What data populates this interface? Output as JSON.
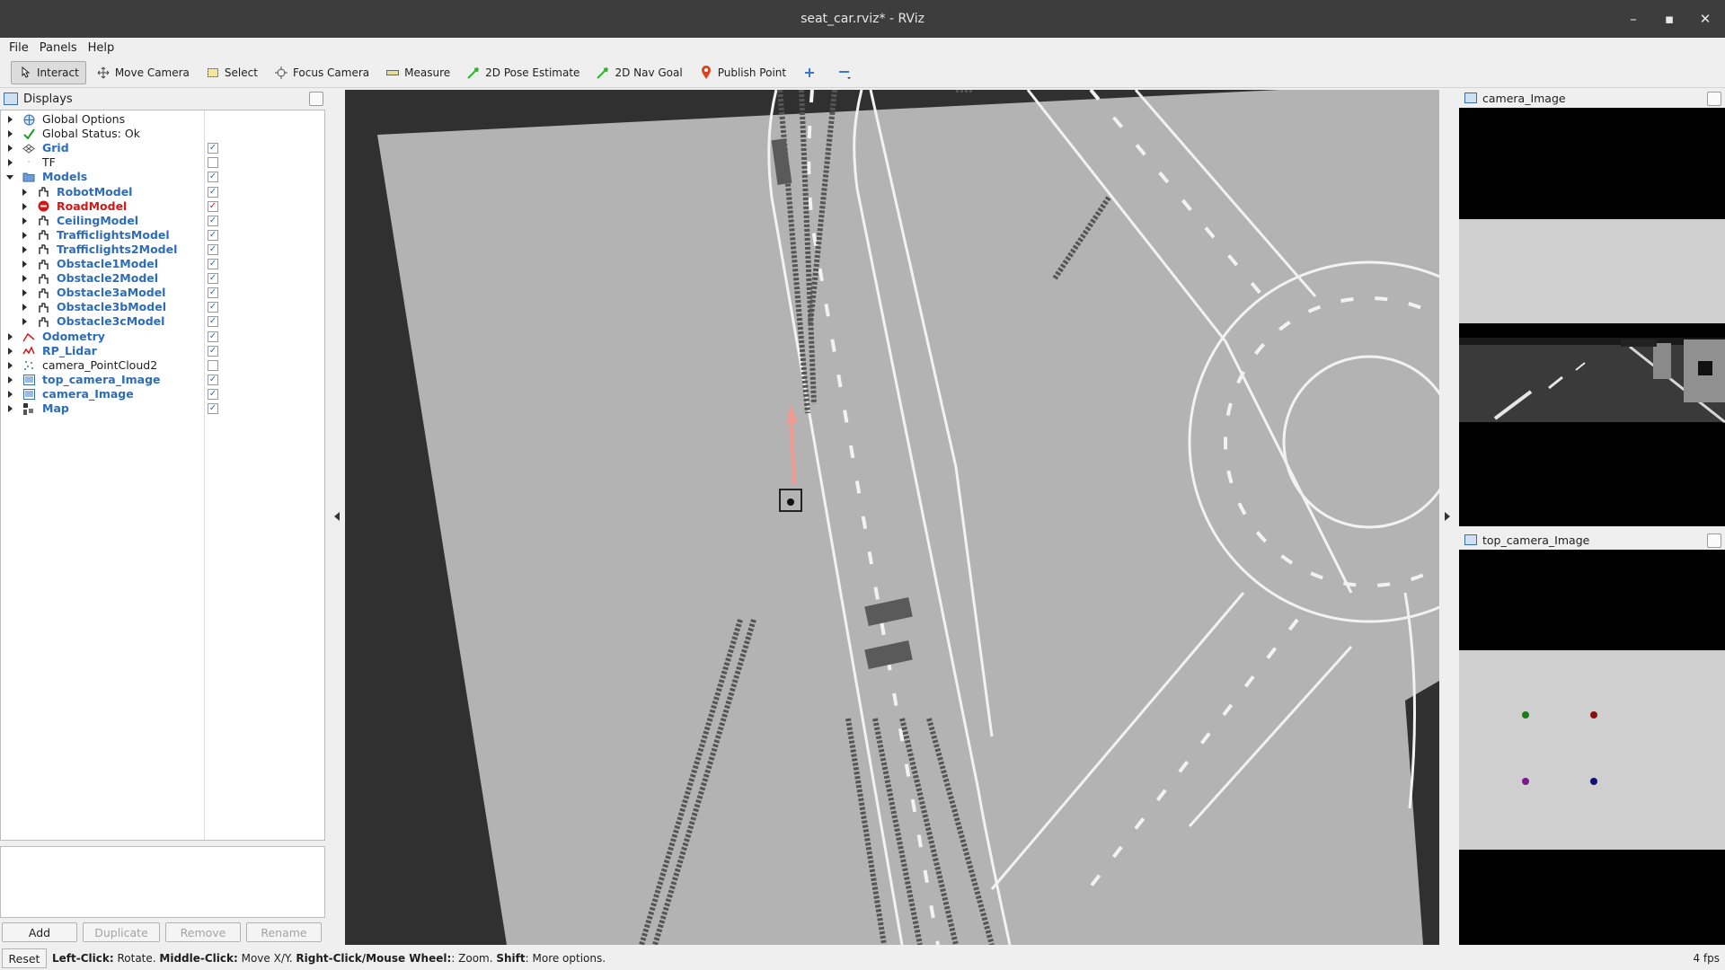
{
  "window": {
    "title": "seat_car.rviz* - RViz"
  },
  "menu": [
    "File",
    "Panels",
    "Help"
  ],
  "toolbar": {
    "tools": [
      {
        "label": "Interact",
        "icon": "cursor-icon",
        "active": true
      },
      {
        "label": "Move Camera",
        "icon": "move-camera-icon",
        "active": false
      },
      {
        "label": "Select",
        "icon": "select-icon",
        "active": false
      },
      {
        "label": "Focus Camera",
        "icon": "focus-camera-icon",
        "active": false
      },
      {
        "label": "Measure",
        "icon": "measure-icon",
        "active": false
      },
      {
        "label": "2D Pose Estimate",
        "icon": "pose-estimate-icon",
        "active": false
      },
      {
        "label": "2D Nav Goal",
        "icon": "nav-goal-icon",
        "active": false
      },
      {
        "label": "Publish Point",
        "icon": "publish-point-icon",
        "active": false
      }
    ]
  },
  "displays": {
    "title": "Displays",
    "items": [
      {
        "label": "Global Options",
        "style": "normal",
        "checked": null
      },
      {
        "label": "Global Status: Ok",
        "style": "normal",
        "checked": null
      },
      {
        "label": "Grid",
        "style": "blue",
        "checked": true
      },
      {
        "label": "TF",
        "style": "normal",
        "checked": false
      },
      {
        "label": "Models",
        "style": "blue",
        "checked": true
      },
      {
        "label": "RobotModel",
        "style": "blue",
        "checked": true
      },
      {
        "label": "RoadModel",
        "style": "red",
        "checked": true
      },
      {
        "label": "CeilingModel",
        "style": "blue",
        "checked": true
      },
      {
        "label": "TrafficlightsModel",
        "style": "blue",
        "checked": true
      },
      {
        "label": "Trafficlights2Model",
        "style": "blue",
        "checked": true
      },
      {
        "label": "Obstacle1Model",
        "style": "blue",
        "checked": true
      },
      {
        "label": "Obstacle2Model",
        "style": "blue",
        "checked": true
      },
      {
        "label": "Obstacle3aModel",
        "style": "blue",
        "checked": true
      },
      {
        "label": "Obstacle3bModel",
        "style": "blue",
        "checked": true
      },
      {
        "label": "Obstacle3cModel",
        "style": "blue",
        "checked": true
      },
      {
        "label": "Odometry",
        "style": "blue",
        "checked": true
      },
      {
        "label": "RP_Lidar",
        "style": "blue",
        "checked": true
      },
      {
        "label": "camera_PointCloud2",
        "style": "normal",
        "checked": false
      },
      {
        "label": "top_camera_Image",
        "style": "blue",
        "checked": true
      },
      {
        "label": "camera_Image",
        "style": "blue",
        "checked": true
      },
      {
        "label": "Map",
        "style": "blue",
        "checked": true
      }
    ],
    "buttons": {
      "add": "Add",
      "duplicate": "Duplicate",
      "remove": "Remove",
      "rename": "Rename"
    }
  },
  "panels": {
    "camera": {
      "title": "camera_Image"
    },
    "top_camera": {
      "title": "top_camera_Image"
    }
  },
  "status": {
    "reset": "Reset",
    "hint_parts": [
      {
        "text": "Left-Click:",
        "bold": true
      },
      {
        "text": " Rotate. ",
        "bold": false
      },
      {
        "text": "Middle-Click:",
        "bold": true
      },
      {
        "text": " Move X/Y. ",
        "bold": false
      },
      {
        "text": "Right-Click/Mouse Wheel:",
        "bold": true
      },
      {
        "text": ": Zoom. ",
        "bold": false
      },
      {
        "text": "Shift",
        "bold": true
      },
      {
        "text": ": More options.",
        "bold": false
      }
    ],
    "fps": "4 fps"
  },
  "colors": {
    "accent_blue": "#2c6cb8",
    "accent_red": "#d11818",
    "map_background": "#303030",
    "road_surface": "#b4b4b4"
  }
}
